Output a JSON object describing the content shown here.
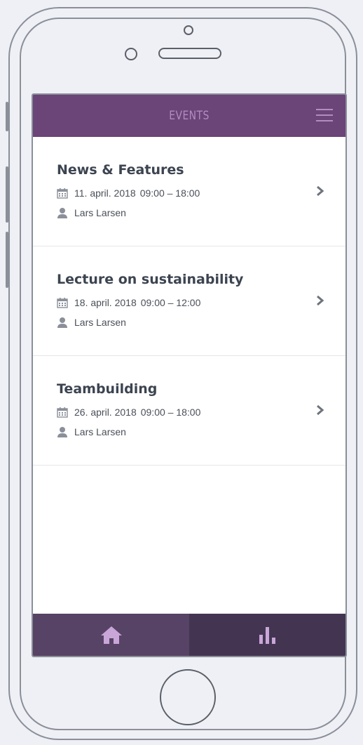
{
  "header": {
    "title": "EVENTS"
  },
  "events": [
    {
      "title": "News & Features",
      "date": "11. april. 2018",
      "time": "09:00 – 18:00",
      "organizer": "Lars Larsen"
    },
    {
      "title": "Lecture on sustainability",
      "date": "18. april. 2018",
      "time": "09:00 – 12:00",
      "organizer": "Lars Larsen"
    },
    {
      "title": "Teambuilding",
      "date": "26. april. 2018",
      "time": "09:00 – 18:00",
      "organizer": "Lars Larsen"
    }
  ],
  "tabs": [
    {
      "icon": "home-icon"
    },
    {
      "icon": "bar-chart-icon"
    }
  ],
  "colors": {
    "header": "#6b4478",
    "header_text": "#b28cc0",
    "tab_active": "#574365",
    "tab_inactive": "#433552",
    "tab_icon": "#c9a6d8"
  }
}
